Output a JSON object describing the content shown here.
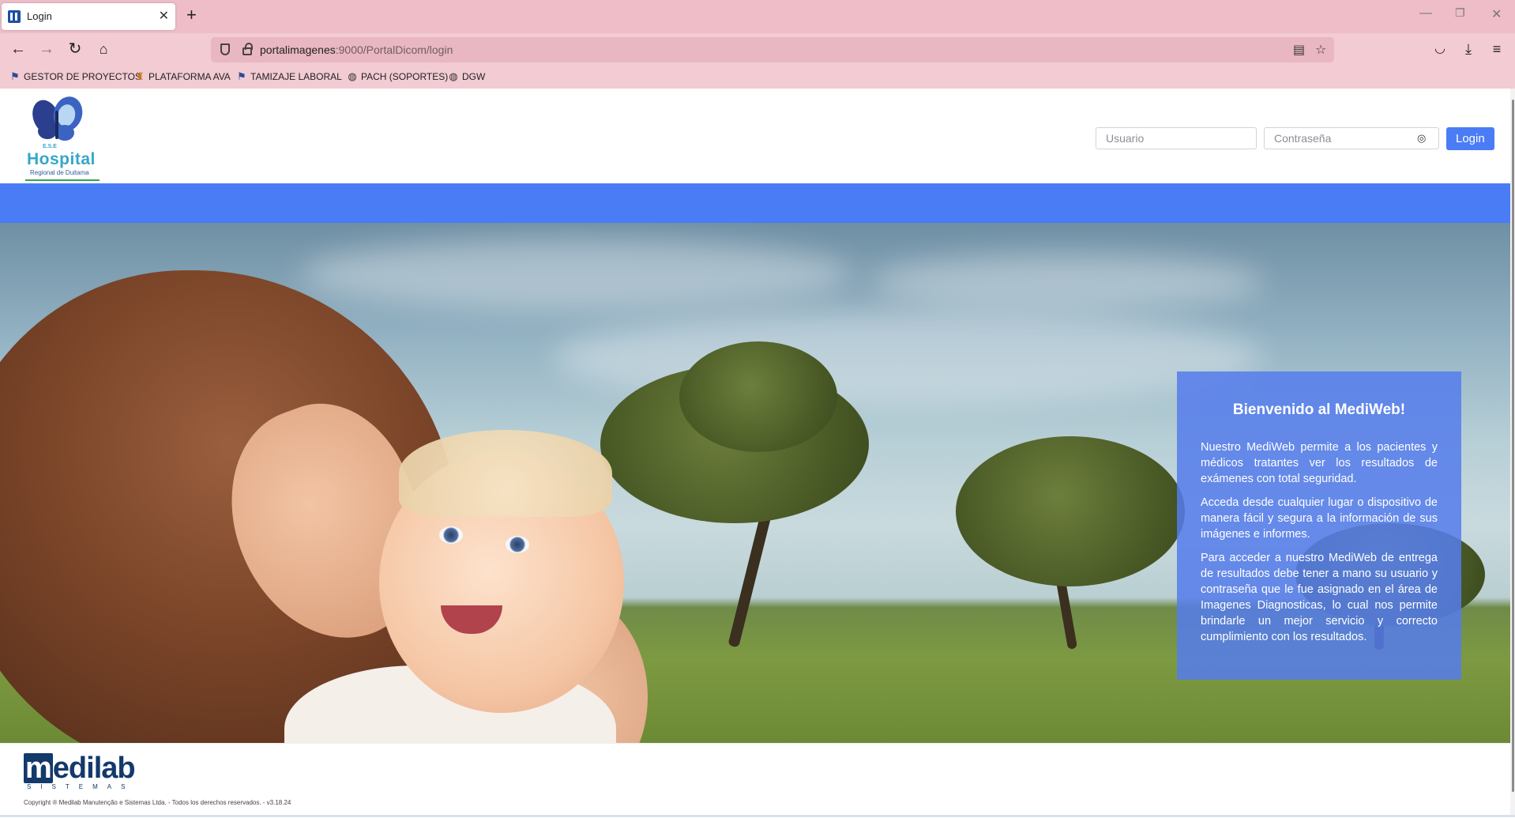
{
  "browser": {
    "tab_title": "Login",
    "url_host": "portalimagenes",
    "url_rest": ":9000/PortalDicom/login",
    "bookmarks": [
      {
        "label": "GESTOR DE PROYECTOS",
        "icon": "flag-icon"
      },
      {
        "label": "PLATAFORMA AVA",
        "icon": "school-icon"
      },
      {
        "label": "TAMIZAJE LABORAL",
        "icon": "flag-icon"
      },
      {
        "label": "PACH (SOPORTES)",
        "icon": "globe-icon"
      },
      {
        "label": "DGW",
        "icon": "globe-icon"
      }
    ]
  },
  "header": {
    "logo_ese": "E.S.E",
    "logo_title": "Hospital",
    "logo_subtitle": "Regional de Duitama",
    "username_placeholder": "Usuario",
    "password_placeholder": "Contraseña",
    "login_label": "Login"
  },
  "colors": {
    "accent": "#4a7cf6",
    "tabbar": "#eebdc7",
    "navbar": "#f2cbd3"
  },
  "welcome": {
    "title": "Bienvenido al MediWeb!",
    "paragraphs": [
      "Nuestro MediWeb permite a los pacientes y médicos tratantes ver los resultados de exámenes con total seguridad.",
      "Acceda desde cualquier lugar o dispositivo de manera fácil y segura a la información de sus imágenes e informes.",
      "Para acceder a nuestro MediWeb de entrega de resultados debe tener a mano su usuario y contraseña que le fue asignado en el área de Imagenes Diagnosticas, lo cual nos permite brindarle un mejor servicio y correcto cumplimiento con los resultados."
    ]
  },
  "footer": {
    "brand_first": "m",
    "brand_rest": "edilab",
    "brand_sub": "SISTEMAS",
    "copyright": "Copyright ® Medilab Manutenção e Sistemas Ltda. - Todos los derechos reservados. - v3.18.24"
  }
}
